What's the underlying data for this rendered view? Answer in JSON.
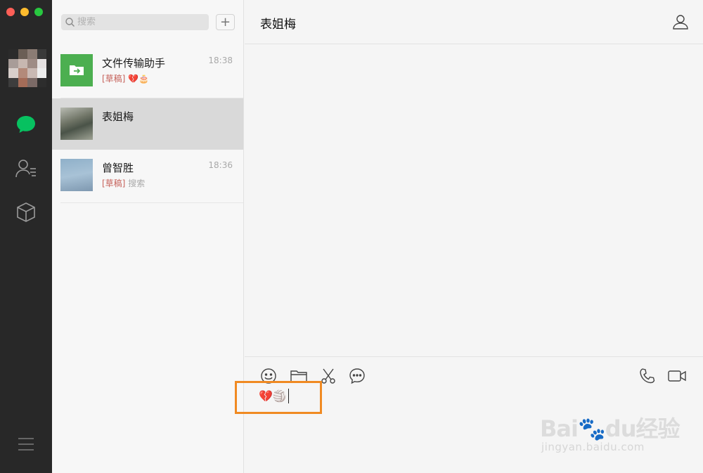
{
  "search": {
    "placeholder": "搜索"
  },
  "toolbar": {
    "add_label": "+"
  },
  "conversations": [
    {
      "name": "文件传输助手",
      "time": "18:38",
      "draft_tag": "[草稿]",
      "preview": "💔🎂"
    },
    {
      "name": "表姐梅",
      "time": "",
      "draft_tag": "",
      "preview": ""
    },
    {
      "name": "曾智胜",
      "time": "18:36",
      "draft_tag": "[草稿]",
      "preview": "搜索"
    }
  ],
  "chat": {
    "title": "表姐梅",
    "composer_text": "💔🏐"
  },
  "icons": {
    "rail": [
      "chat-icon",
      "contacts-icon",
      "cube-icon",
      "menu-icon"
    ],
    "composer_tools": [
      "emoji-icon",
      "folder-icon",
      "scissors-icon",
      "chat-bubble-icon"
    ],
    "call_tools": [
      "phone-icon",
      "video-icon"
    ]
  },
  "colors": {
    "rail": "#282828",
    "active_chat_icon": "#07c160",
    "file_helper": "#4caf50",
    "draft": "#c6635c",
    "highlight": "#f08a22"
  },
  "watermark": {
    "brand": "Bai🐾du经验",
    "url": "jingyan.baidu.com"
  }
}
